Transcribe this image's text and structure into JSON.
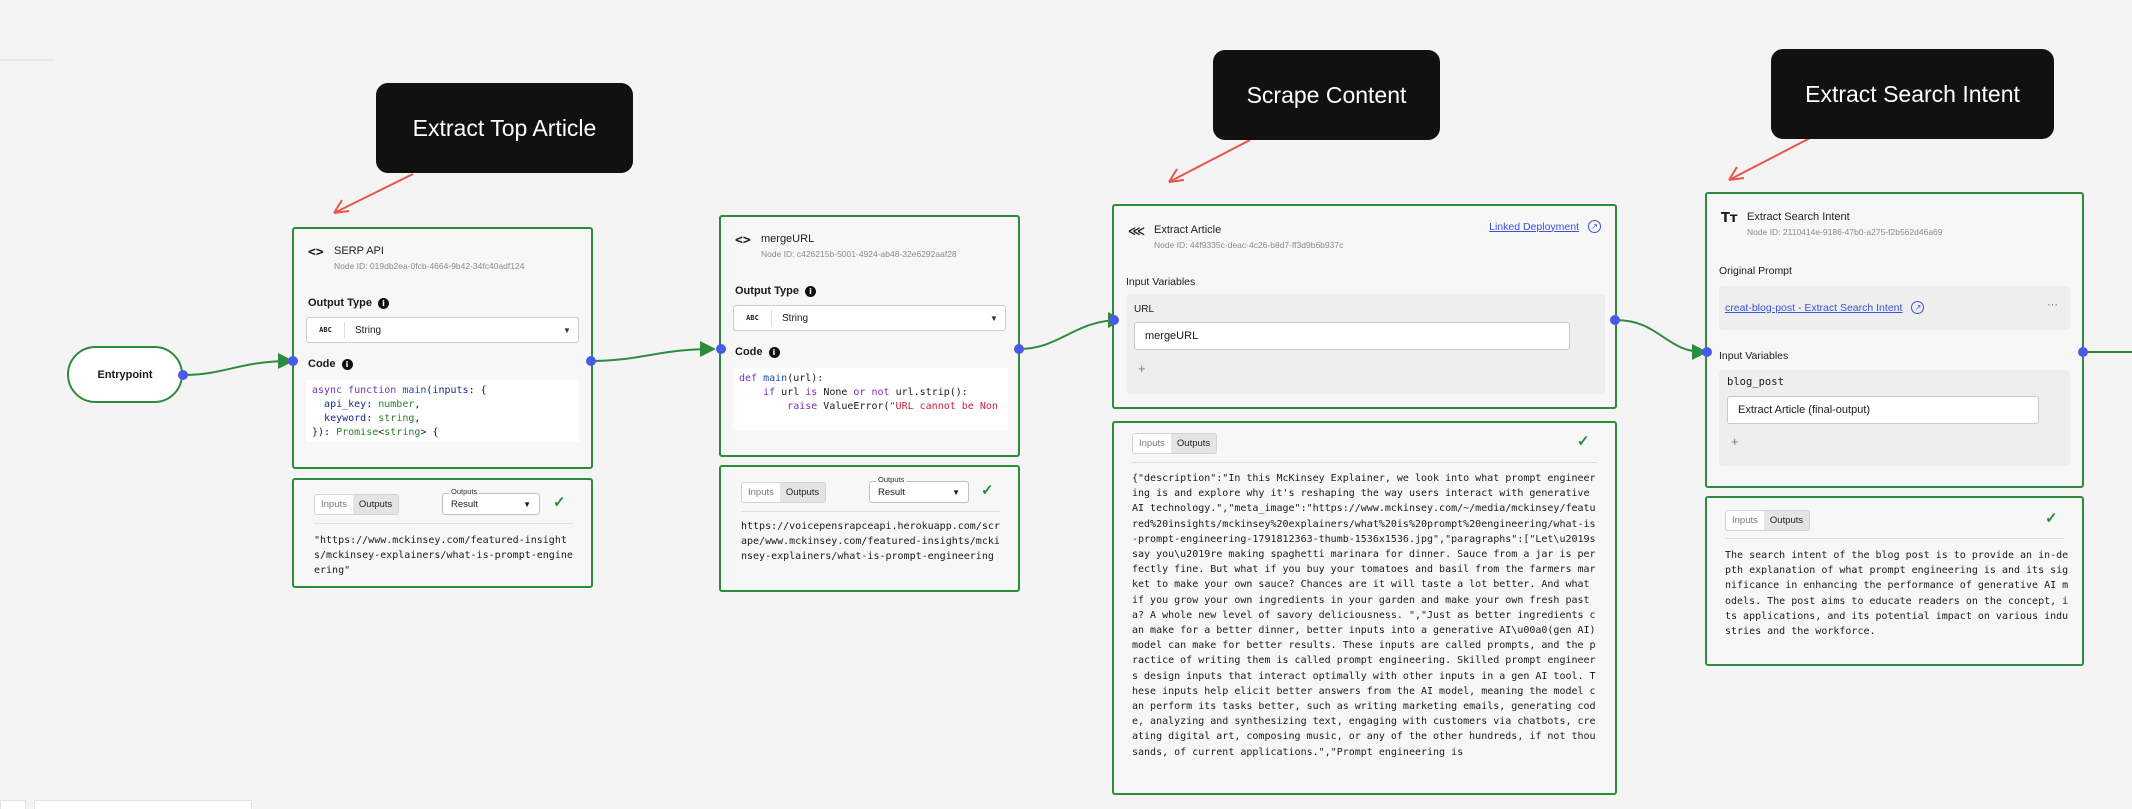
{
  "callouts": {
    "extract_top_article": "Extract Top Article",
    "scrape_content": "Scrape Content",
    "extract_search_intent": "Extract Search Intent"
  },
  "entrypoint": {
    "label": "Entrypoint"
  },
  "serp_node": {
    "title": "SERP API",
    "node_id": "Node ID: 019db2ea-0fcb-4664-9b42-34fc40adf124",
    "output_type_label": "Output Type",
    "output_type_tag": "ABC",
    "output_type_value": "String",
    "code_label": "Code"
  },
  "serp_output": {
    "tab_inputs": "Inputs",
    "tab_outputs": "Outputs",
    "select_legend": "Outputs",
    "select_value": "Result",
    "text": "\"https://www.mckinsey.com/featured-insights/mckinsey-explainers/what-is-prompt-engineering\""
  },
  "merge_node": {
    "title": "mergeURL",
    "node_id": "Node ID: c426215b-5001-4924-ab48-32e6292aaf28",
    "output_type_label": "Output Type",
    "output_type_tag": "ABC",
    "output_type_value": "String",
    "code_label": "Code"
  },
  "merge_output": {
    "tab_inputs": "Inputs",
    "tab_outputs": "Outputs",
    "select_legend": "Outputs",
    "select_value": "Result",
    "text": "https://voicepensrapceapi.herokuapp.com/scrape/www.mckinsey.com/featured-insights/mckinsey-explainers/what-is-prompt-engineering"
  },
  "extract_article_node": {
    "title": "Extract Article",
    "node_id": "Node ID: 44f9335c-deac-4c26-b8d7-ff3d9b6b937c",
    "linked_deployment": "Linked Deployment",
    "input_variables_label": "Input Variables",
    "var_name": "URL",
    "var_value": "mergeURL",
    "add": "+"
  },
  "extract_article_output": {
    "tab_inputs": "Inputs",
    "tab_outputs": "Outputs",
    "text": "{\"description\":\"In this McKinsey Explainer, we look into what prompt engineering is and explore why it's reshaping the way users interact with generative AI technology.\",\"meta_image\":\"https://www.mckinsey.com/~/media/mckinsey/featured%20insights/mckinsey%20explainers/what%20is%20prompt%20engineering/what-is-prompt-engineering-1791812363-thumb-1536x1536.jpg\",\"paragraphs\":[\"Let\\u2019s say you\\u2019re making spaghetti marinara for dinner. Sauce from a jar is perfectly fine. But what if you buy your tomatoes and basil from the farmers market to make your own sauce? Chances are it will taste a lot better. And what if you grow your own ingredients in your garden and make your own fresh pasta? A whole new level of savory deliciousness. \",\"Just as better ingredients can make for a better dinner, better inputs into a generative AI\\u00a0(gen AI) model can make for better results. These inputs are called prompts, and the practice of writing them is called prompt engineering. Skilled prompt engineers design inputs that interact optimally with other inputs in a gen AI tool. These inputs help elicit better answers from the AI model, meaning the model can perform its tasks better, such as writing marketing emails, generating code, analyzing and synthesizing text, engaging with customers via chatbots, creating digital art, composing music, or any of the other hundreds, if not thousands, of current applications.\",\"Prompt engineering is"
  },
  "search_intent_node": {
    "title": "Extract Search Intent",
    "node_id": "Node ID: 2110414e-9186-47b0-a275-f2b562d46a69",
    "original_prompt_label": "Original Prompt",
    "prompt_link": "creat-blog-post - Extract Search Intent",
    "more": "···",
    "input_variables_label": "Input Variables",
    "var_name": "blog_post",
    "var_value": "Extract Article (final-output)",
    "add": "+"
  },
  "search_intent_output": {
    "tab_inputs": "Inputs",
    "tab_outputs": "Outputs",
    "text": "The search intent of the blog post is to provide an in-depth explanation of what prompt engineering is and its significance in enhancing the performance of generative AI models. The post aims to educate readers on the concept, its applications, and its potential impact on various industries and the workforce."
  },
  "colors": {
    "edge": "#2e8b3e",
    "handle": "#4a5ae8",
    "arrow": "#e9554a",
    "callout": "#111111"
  },
  "icons": [
    "code-icon",
    "info-icon",
    "chevron-down-icon",
    "check-icon",
    "workflow-icon",
    "external-link-icon",
    "text-icon",
    "more-icon",
    "plus-icon"
  ]
}
